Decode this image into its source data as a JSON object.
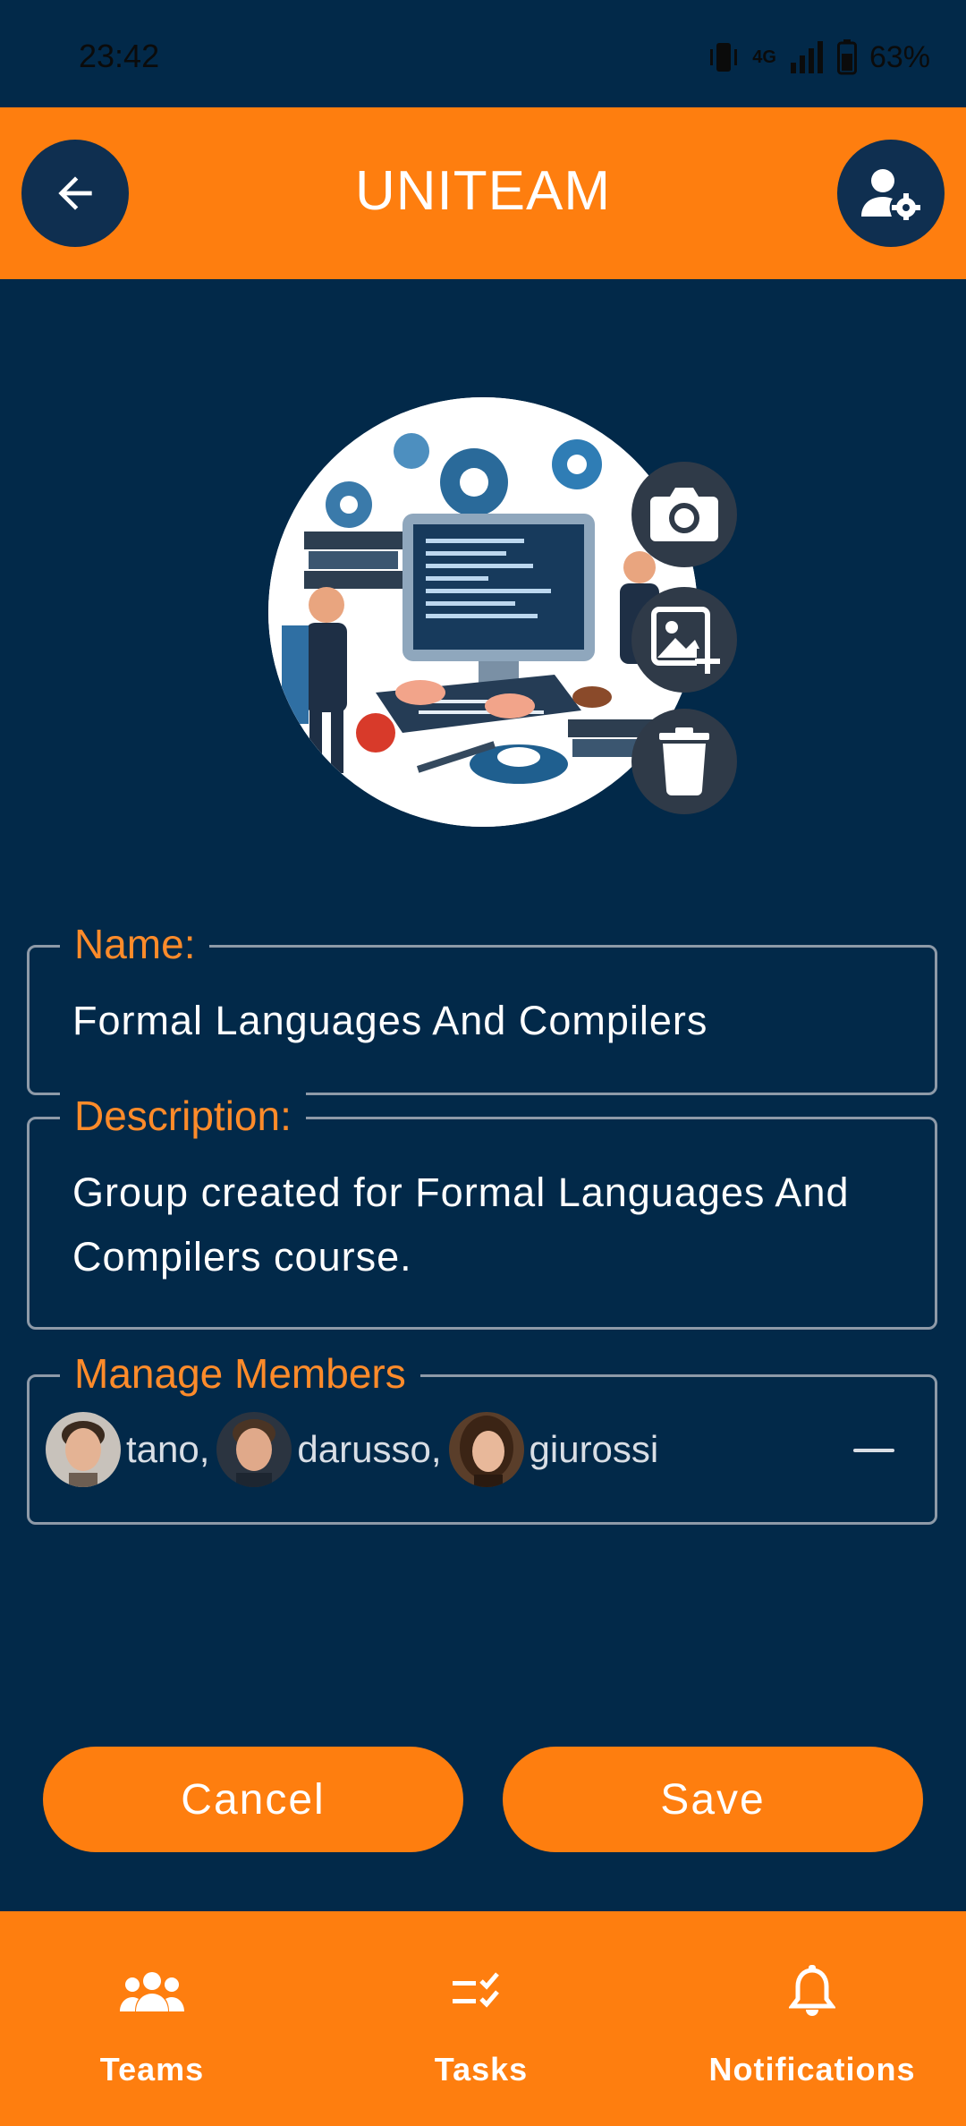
{
  "status_bar": {
    "time": "23:42",
    "network": "4G",
    "battery": "63%"
  },
  "app_bar": {
    "title": "UNITEAM",
    "back_icon": "arrow-left-icon",
    "settings_icon": "user-gear-icon"
  },
  "team_image": {
    "actions": [
      "camera-icon",
      "add-photo-icon",
      "trash-icon"
    ]
  },
  "form": {
    "name_label": "Name:",
    "name_value": "Formal Languages And Compilers",
    "description_label": "Description:",
    "description_value": "Group created for Formal Languages And Compilers course.",
    "members_label": "Manage Members",
    "members": [
      {
        "name": "tano,"
      },
      {
        "name": "darusso,"
      },
      {
        "name": "giurossi"
      }
    ]
  },
  "buttons": {
    "cancel": "Cancel",
    "save": "Save"
  },
  "bottom_nav": {
    "items": [
      {
        "label": "Teams",
        "icon": "group-icon"
      },
      {
        "label": "Tasks",
        "icon": "checklist-icon"
      },
      {
        "label": "Notifications",
        "icon": "bell-icon"
      }
    ]
  },
  "colors": {
    "background": "#022949",
    "accent": "#fe7e0f",
    "label": "#ff8b2a"
  }
}
